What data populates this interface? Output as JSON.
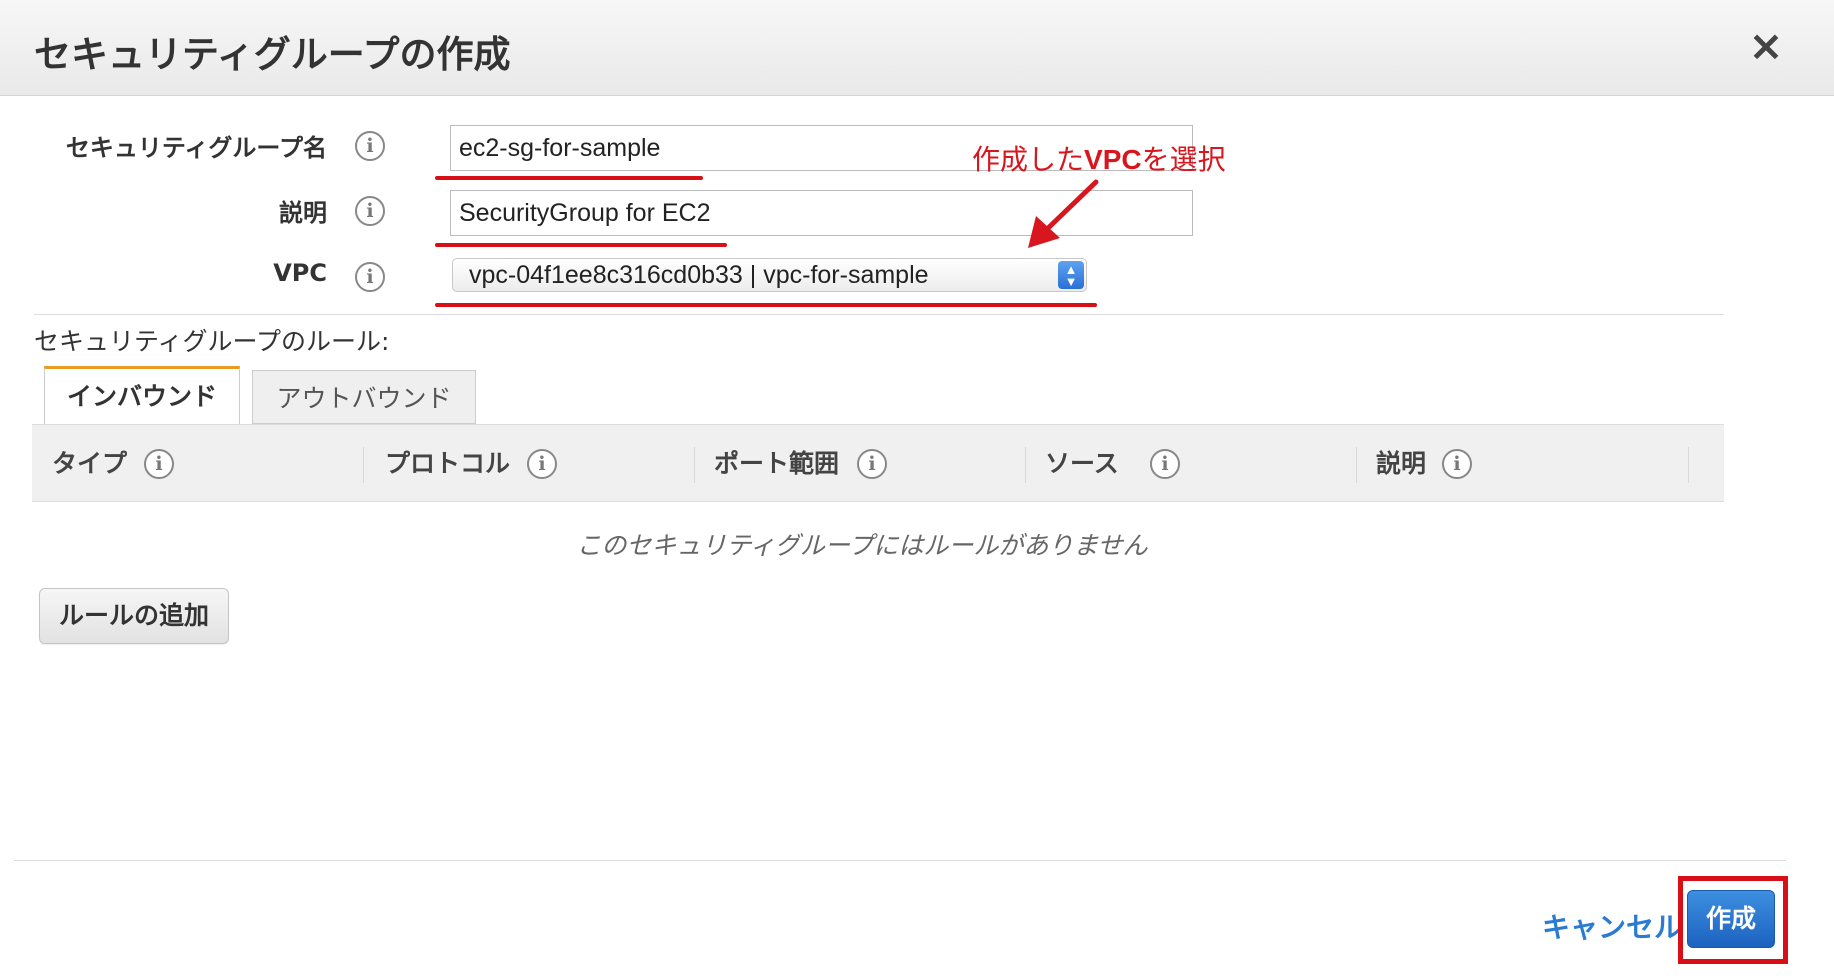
{
  "dialog": {
    "title": "セキュリティグループの作成",
    "close_icon": "×"
  },
  "form": {
    "name": {
      "label": "セキュリティグループ名",
      "value": "ec2-sg-for-sample"
    },
    "description": {
      "label": "説明",
      "value": "SecurityGroup for EC2"
    },
    "vpc": {
      "label": "VPC",
      "value": "vpc-04f1ee8c316cd0b33 | vpc-for-sample"
    },
    "info_icon": "i"
  },
  "annotation": {
    "prefix": "作成した",
    "emphasis": "VPC",
    "suffix": "を選択",
    "color": "#d8161e"
  },
  "rules": {
    "label": "セキュリティグループのルール:",
    "tabs": [
      {
        "label": "インバウンド",
        "active": true
      },
      {
        "label": "アウトバウンド",
        "active": false
      }
    ],
    "columns": [
      "タイプ",
      "プロトコル",
      "ポート範囲",
      "ソース",
      "説明"
    ],
    "empty_message": "このセキュリティグループにはルールがありません",
    "add_button": "ルールの追加"
  },
  "footer": {
    "cancel": "キャンセル",
    "create": "作成"
  },
  "colors": {
    "accent": "#2a7bd1",
    "highlight": "#d80f16",
    "tab_active_border": "#e79c1f"
  }
}
